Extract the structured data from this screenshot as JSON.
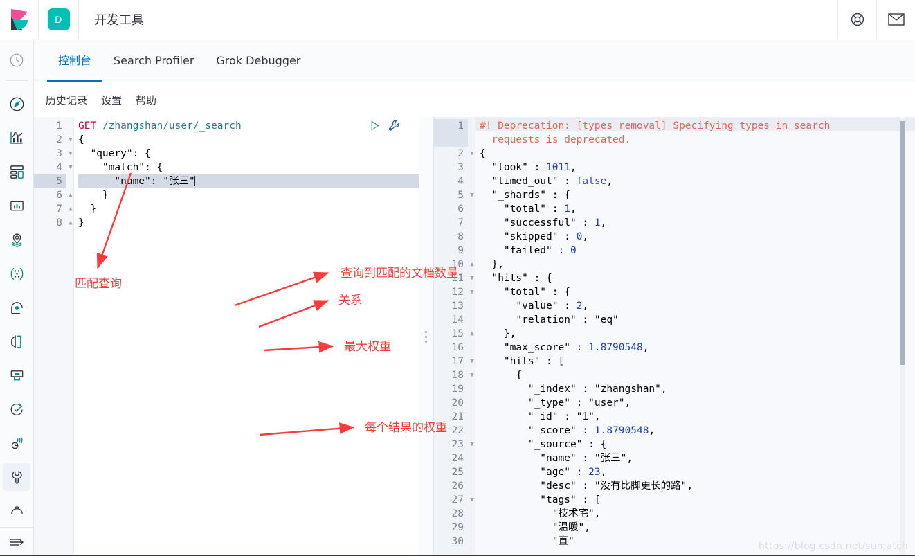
{
  "header": {
    "title": "开发工具",
    "space_badge": "D",
    "logo_name": "kibana-logo",
    "help_icon": "life-ring-icon",
    "news_icon": "mail-icon"
  },
  "rail": {
    "items": [
      {
        "name": "recently-viewed",
        "icon": "clock-icon"
      },
      {
        "name": "discover",
        "icon": "compass-icon"
      },
      {
        "name": "visualize",
        "icon": "bar-chart-icon"
      },
      {
        "name": "dashboard",
        "icon": "dashboard-grid-icon"
      },
      {
        "name": "canvas",
        "icon": "presentation-icon"
      },
      {
        "name": "maps",
        "icon": "map-pin-layers-icon"
      },
      {
        "name": "machine-learning",
        "icon": "network-nodes-icon"
      },
      {
        "name": "infrastructure",
        "icon": "infra-icon"
      },
      {
        "name": "logs",
        "icon": "logs-pages-icon"
      },
      {
        "name": "apm",
        "icon": "apm-icon"
      },
      {
        "name": "uptime",
        "icon": "uptime-check-icon"
      },
      {
        "name": "siem",
        "icon": "siem-signal-icon"
      },
      {
        "name": "dev-tools",
        "icon": "wrench-icon",
        "active": true
      },
      {
        "name": "management",
        "icon": "gear-cog-icon"
      }
    ],
    "collapse_icon": "collapse-arrow-icon"
  },
  "tabs": [
    {
      "label": "控制台",
      "active": true
    },
    {
      "label": "Search Profiler",
      "active": false
    },
    {
      "label": "Grok Debugger",
      "active": false
    }
  ],
  "subbar": {
    "links": [
      "历史记录",
      "设置",
      "帮助"
    ]
  },
  "editor": {
    "play_icon": "play-triangle-icon",
    "wrench_icon": "wrench-settings-icon",
    "active_line": 5,
    "lines": [
      {
        "no": 1,
        "fold": "",
        "text": "GET /zhangshan/user/_search"
      },
      {
        "no": 2,
        "fold": "open",
        "text": "{"
      },
      {
        "no": 3,
        "fold": "open",
        "text": "  \"query\": {"
      },
      {
        "no": 4,
        "fold": "open",
        "text": "    \"match\": {"
      },
      {
        "no": 5,
        "fold": "",
        "text": "      \"name\": \"张三\""
      },
      {
        "no": 6,
        "fold": "close",
        "text": "    }"
      },
      {
        "no": 7,
        "fold": "close",
        "text": "  }"
      },
      {
        "no": 8,
        "fold": "close",
        "text": "}"
      }
    ]
  },
  "response": {
    "lines": [
      {
        "no": 1,
        "fold": "",
        "text": "#! Deprecation: [types removal] Specifying types in search"
      },
      {
        "no": "",
        "fold": "",
        "text": "  requests is deprecated."
      },
      {
        "no": 2,
        "fold": "open",
        "text": "{"
      },
      {
        "no": 3,
        "fold": "",
        "text": "  \"took\" : 1011,"
      },
      {
        "no": 4,
        "fold": "",
        "text": "  \"timed_out\" : false,"
      },
      {
        "no": 5,
        "fold": "open",
        "text": "  \"_shards\" : {"
      },
      {
        "no": 6,
        "fold": "",
        "text": "    \"total\" : 1,"
      },
      {
        "no": 7,
        "fold": "",
        "text": "    \"successful\" : 1,"
      },
      {
        "no": 8,
        "fold": "",
        "text": "    \"skipped\" : 0,"
      },
      {
        "no": 9,
        "fold": "",
        "text": "    \"failed\" : 0"
      },
      {
        "no": 10,
        "fold": "close",
        "text": "  },"
      },
      {
        "no": 11,
        "fold": "open",
        "text": "  \"hits\" : {"
      },
      {
        "no": 12,
        "fold": "open",
        "text": "    \"total\" : {"
      },
      {
        "no": 13,
        "fold": "",
        "text": "      \"value\" : 2,"
      },
      {
        "no": 14,
        "fold": "",
        "text": "      \"relation\" : \"eq\""
      },
      {
        "no": 15,
        "fold": "close",
        "text": "    },"
      },
      {
        "no": 16,
        "fold": "",
        "text": "    \"max_score\" : 1.8790548,"
      },
      {
        "no": 17,
        "fold": "open",
        "text": "    \"hits\" : ["
      },
      {
        "no": 18,
        "fold": "open",
        "text": "      {"
      },
      {
        "no": 19,
        "fold": "",
        "text": "        \"_index\" : \"zhangshan\","
      },
      {
        "no": 20,
        "fold": "",
        "text": "        \"_type\" : \"user\","
      },
      {
        "no": 21,
        "fold": "",
        "text": "        \"_id\" : \"1\","
      },
      {
        "no": 22,
        "fold": "",
        "text": "        \"_score\" : 1.8790548,"
      },
      {
        "no": 23,
        "fold": "open",
        "text": "        \"_source\" : {"
      },
      {
        "no": 24,
        "fold": "",
        "text": "          \"name\" : \"张三\","
      },
      {
        "no": 25,
        "fold": "",
        "text": "          \"age\" : 23,"
      },
      {
        "no": 26,
        "fold": "",
        "text": "          \"desc\" : \"没有比脚更长的路\","
      },
      {
        "no": 27,
        "fold": "open",
        "text": "          \"tags\" : ["
      },
      {
        "no": 28,
        "fold": "",
        "text": "            \"技术宅\","
      },
      {
        "no": 29,
        "fold": "",
        "text": "            \"温暖\","
      },
      {
        "no": 30,
        "fold": "",
        "text": "            \"直\""
      }
    ]
  },
  "annotations": [
    {
      "name": "annotation-match-query",
      "text": "匹配查询"
    },
    {
      "name": "annotation-doc-count",
      "text": "查询到匹配的文档数量"
    },
    {
      "name": "annotation-relation",
      "text": "关系"
    },
    {
      "name": "annotation-max-score",
      "text": "最大权重"
    },
    {
      "name": "annotation-each-score",
      "text": "每个结果的权重"
    }
  ],
  "watermark": "https://blog.csdn.net/sumatch",
  "colors": {
    "accent_blue": "#0071c2",
    "teal": "#00bfb3",
    "annotation_red": "#fb3b3b",
    "method": "#c7004c",
    "string": "#12824a",
    "key": "#1f3fb0",
    "deprecation": "#e7664c"
  }
}
